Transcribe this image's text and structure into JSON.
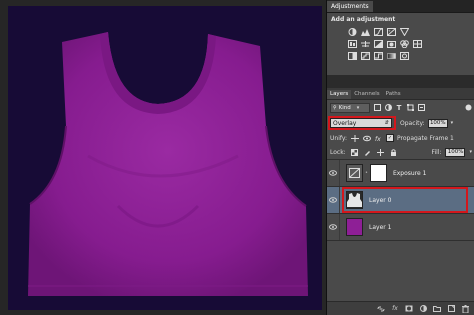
{
  "adjustments_panel": {
    "tab_label": "Adjustments",
    "title": "Add an adjustment",
    "row1_icons": [
      "brightness-contrast-icon",
      "levels-icon",
      "curves-icon",
      "exposure-icon",
      "vibrance-icon"
    ],
    "row2_icons": [
      "hue-saturation-icon",
      "color-balance-icon",
      "black-white-icon",
      "photo-filter-icon",
      "channel-mixer-icon",
      "color-lookup-icon"
    ],
    "row3_icons": [
      "invert-icon",
      "posterize-icon",
      "threshold-icon",
      "gradient-map-icon",
      "selective-color-icon"
    ]
  },
  "layers_panel": {
    "tabs": [
      "Layers",
      "Channels",
      "Paths"
    ],
    "kind_label": "Kind",
    "blend_mode": "Overlay",
    "opacity_label": "Opacity:",
    "opacity_value": "100%",
    "unify_label": "Unify:",
    "propagate_label": "Propagate Frame 1",
    "lock_label": "Lock:",
    "fill_label": "Fill:",
    "fill_value": "100%",
    "layers": [
      {
        "name": "Exposure 1",
        "selected": false
      },
      {
        "name": "Layer 0",
        "selected": true
      },
      {
        "name": "Layer 1",
        "selected": false
      }
    ]
  },
  "colors": {
    "shirt": "#8e1f96",
    "canvas_bg": "#170b36",
    "highlight": "#d3171c",
    "selected_layer": "#5b6d83"
  }
}
